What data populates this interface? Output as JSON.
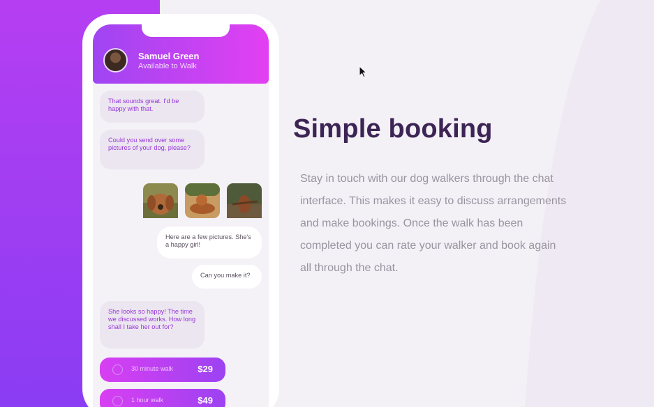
{
  "chat": {
    "contact_name": "Samuel Green",
    "contact_status": "Available to Walk",
    "messages": [
      {
        "from": "walker",
        "text": "That sounds great. I'd be happy with that."
      },
      {
        "from": "walker",
        "text": "Could you send over some pictures of your dog, please?"
      },
      {
        "from": "owner",
        "text": "Here are a few pictures. She's a happy girl!"
      },
      {
        "from": "owner",
        "text": "Can you make it?"
      },
      {
        "from": "walker",
        "text": "She looks so happy! The time we discussed works. How long shall I take her out for?"
      }
    ],
    "photos": [
      {
        "icon": "dog-photo-1",
        "color": "#b06a3a"
      },
      {
        "icon": "dog-photo-2",
        "color": "#a85a2a"
      },
      {
        "icon": "dog-photo-3",
        "color": "#8a4a2a"
      }
    ],
    "options": [
      {
        "label": "30 minute walk",
        "price": "$29"
      },
      {
        "label": "1 hour walk",
        "price": "$49"
      }
    ]
  },
  "hero": {
    "title": "Simple booking",
    "description": "Stay in touch with our dog walkers through the chat interface. This makes it easy to discuss arrangements and make bookings. Once the walk has been completed you can rate your walker and book again all through the chat."
  },
  "colors": {
    "accent_purple": "#9f45f2",
    "accent_pink": "#e240f2",
    "title": "#3c2454",
    "body_text": "#9a94a0"
  }
}
